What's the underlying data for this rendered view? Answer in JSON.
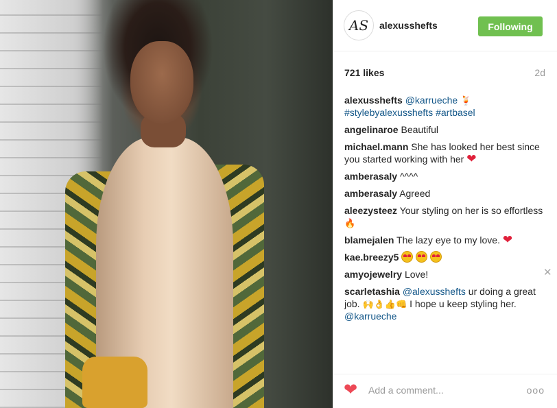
{
  "post": {
    "username": "alexusshefts",
    "avatar_initials": "AS",
    "follow_label": "Following",
    "likes": "721 likes",
    "time": "2d"
  },
  "comments": [
    {
      "user": "alexusshefts",
      "parts": [
        {
          "t": "link",
          "v": "@karrueche"
        },
        {
          "t": "emoji",
          "v": "🍹"
        },
        {
          "t": "br"
        },
        {
          "t": "link",
          "v": "#stylebyalexusshefts"
        },
        {
          "t": "text",
          "v": " "
        },
        {
          "t": "link",
          "v": "#artbasel"
        }
      ]
    },
    {
      "user": "angelinaroe",
      "parts": [
        {
          "t": "text",
          "v": "Beautiful"
        }
      ]
    },
    {
      "user": "michael.mann",
      "parts": [
        {
          "t": "text",
          "v": "She has looked her best since you started working with her"
        },
        {
          "t": "emoji",
          "v": "❤",
          "c": "e-heart"
        }
      ]
    },
    {
      "user": "amberasaly",
      "parts": [
        {
          "t": "text",
          "v": "^^^^"
        }
      ]
    },
    {
      "user": "amberasaly",
      "parts": [
        {
          "t": "text",
          "v": "Agreed"
        }
      ]
    },
    {
      "user": "aleezysteez",
      "parts": [
        {
          "t": "text",
          "v": "Your styling on her is so effortless"
        },
        {
          "t": "emoji",
          "v": "🔥",
          "c": "e-fire"
        }
      ]
    },
    {
      "user": "blamejalen",
      "parts": [
        {
          "t": "text",
          "v": "The lazy eye to my love."
        },
        {
          "t": "emoji",
          "v": "❤",
          "c": "e-heart"
        }
      ]
    },
    {
      "user": "kae.breezy5",
      "parts": [
        {
          "t": "face"
        },
        {
          "t": "face"
        },
        {
          "t": "face"
        }
      ]
    },
    {
      "user": "amyojewelry",
      "parts": [
        {
          "t": "text",
          "v": "Love!"
        }
      ],
      "closable": true
    },
    {
      "user": "scarletashia",
      "parts": [
        {
          "t": "link",
          "v": "@alexusshefts"
        },
        {
          "t": "text",
          "v": " ur doing a great job."
        },
        {
          "t": "emoji",
          "v": "🙌👌👍👊"
        },
        {
          "t": "text",
          "v": " I hope u keep styling her."
        },
        {
          "t": "br"
        },
        {
          "t": "link",
          "v": "@karrueche"
        }
      ]
    }
  ],
  "footer": {
    "comment_placeholder": "Add a comment...",
    "more_label": "ooo"
  },
  "icons": {
    "heart": "heart-icon",
    "close": "close-icon",
    "more": "more-options-icon"
  },
  "colors": {
    "follow_bg": "#70c050",
    "link": "#125688",
    "like_heart": "#ed4956"
  }
}
